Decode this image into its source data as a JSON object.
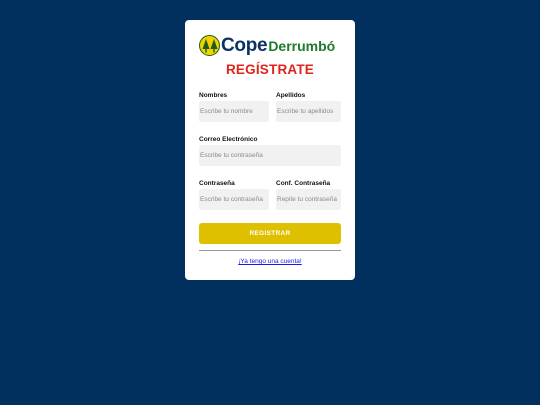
{
  "brand": {
    "name_part1": "Cope",
    "name_part2": "Derrumbó",
    "colors": {
      "background": "#01305f",
      "accent_yellow": "#dfc000",
      "title_red": "#e0241b",
      "brand_blue": "#0c3166",
      "brand_green": "#1f7a2b"
    }
  },
  "form": {
    "title": "REGÍSTRATE",
    "fields": {
      "first_name": {
        "label": "Nombres",
        "placeholder": "Escribe tu nombre",
        "value": ""
      },
      "last_name": {
        "label": "Apellidos",
        "placeholder": "Escribe tu apellidos",
        "value": ""
      },
      "email": {
        "label": "Correo Electrónico",
        "placeholder": "Escribe tu contraseña",
        "value": ""
      },
      "password": {
        "label": "Contraseña",
        "placeholder": "Escribe tu contraseña",
        "value": ""
      },
      "confirm_password": {
        "label": "Conf. Contraseña",
        "placeholder": "Repite tu contraseña",
        "value": ""
      }
    },
    "submit_label": "REGISTRAR",
    "login_link": "¡Ya tengo una cuenta!"
  }
}
